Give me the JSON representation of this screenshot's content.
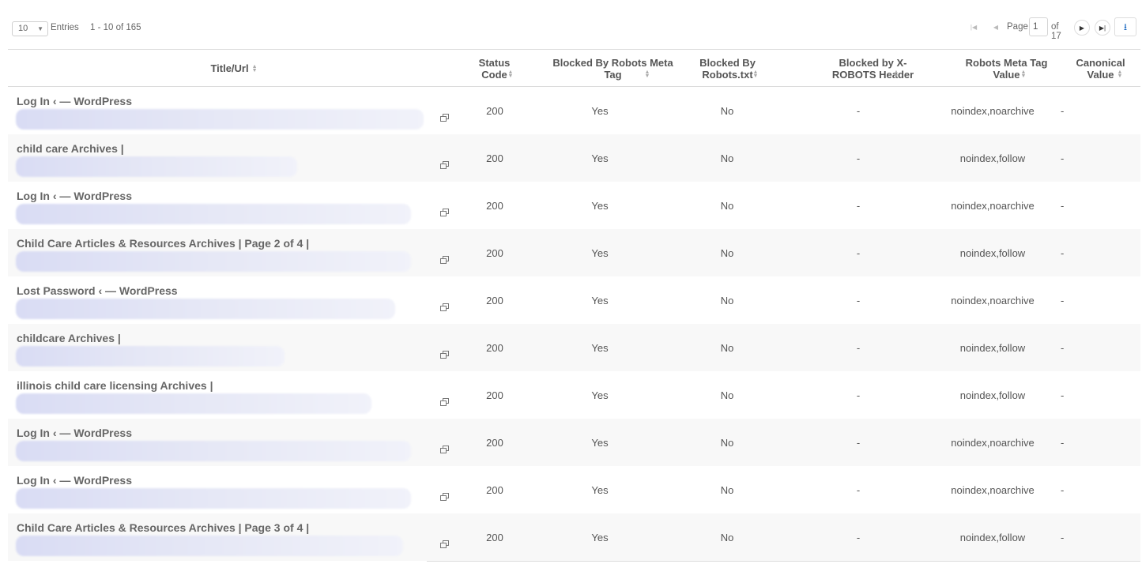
{
  "toolbar": {
    "entries_value": "10",
    "entries_label": "Entries",
    "range": "1 - 10 of 165",
    "page_label": "Page",
    "page_value": "1",
    "page_of": "of 17"
  },
  "icons": {
    "first": "first-page-icon",
    "prev": "prev-page-icon",
    "next": "next-page-icon",
    "last": "last-page-icon",
    "download": "download-icon",
    "sort": "sort-icon",
    "external_link": "external-link-icon"
  },
  "colors": {
    "accent": "#1565c0",
    "text": "#555555",
    "row_alt": "#f8f8f8",
    "border": "#dcdcdc"
  },
  "table": {
    "headers": {
      "title_url": "Title/Url",
      "status_code": "Status Code",
      "robots_meta": "Blocked By Robots Meta Tag",
      "robots_txt": "Blocked By Robots.txt",
      "x_robots": "Blocked by X-ROBOTS Header",
      "meta_value": "Robots Meta Tag Value",
      "canonical": "Canonical Value"
    },
    "rows": [
      {
        "title": "Log In ‹ — WordPress",
        "status": "200",
        "meta": "Yes",
        "txt": "No",
        "xrobots": "-",
        "meta_value": "noindex,noarchive",
        "canonical": "-"
      },
      {
        "title": "child care Archives |",
        "status": "200",
        "meta": "Yes",
        "txt": "No",
        "xrobots": "-",
        "meta_value": "noindex,follow",
        "canonical": "-"
      },
      {
        "title": "Log In ‹ — WordPress",
        "status": "200",
        "meta": "Yes",
        "txt": "No",
        "xrobots": "-",
        "meta_value": "noindex,noarchive",
        "canonical": "-"
      },
      {
        "title": "Child Care Articles & Resources Archives | Page 2 of 4 |",
        "status": "200",
        "meta": "Yes",
        "txt": "No",
        "xrobots": "-",
        "meta_value": "noindex,follow",
        "canonical": "-"
      },
      {
        "title": "Lost Password ‹ — WordPress",
        "status": "200",
        "meta": "Yes",
        "txt": "No",
        "xrobots": "-",
        "meta_value": "noindex,noarchive",
        "canonical": "-"
      },
      {
        "title": "childcare Archives |",
        "status": "200",
        "meta": "Yes",
        "txt": "No",
        "xrobots": "-",
        "meta_value": "noindex,follow",
        "canonical": "-"
      },
      {
        "title": "illinois child care licensing Archives |",
        "status": "200",
        "meta": "Yes",
        "txt": "No",
        "xrobots": "-",
        "meta_value": "noindex,follow",
        "canonical": "-"
      },
      {
        "title": "Log In ‹ — WordPress",
        "status": "200",
        "meta": "Yes",
        "txt": "No",
        "xrobots": "-",
        "meta_value": "noindex,noarchive",
        "canonical": "-"
      },
      {
        "title": "Log In ‹ — WordPress",
        "status": "200",
        "meta": "Yes",
        "txt": "No",
        "xrobots": "-",
        "meta_value": "noindex,noarchive",
        "canonical": "-"
      },
      {
        "title": "Child Care Articles & Resources Archives | Page 3 of 4 |",
        "status": "200",
        "meta": "Yes",
        "txt": "No",
        "xrobots": "-",
        "meta_value": "noindex,follow",
        "canonical": "-"
      }
    ]
  }
}
